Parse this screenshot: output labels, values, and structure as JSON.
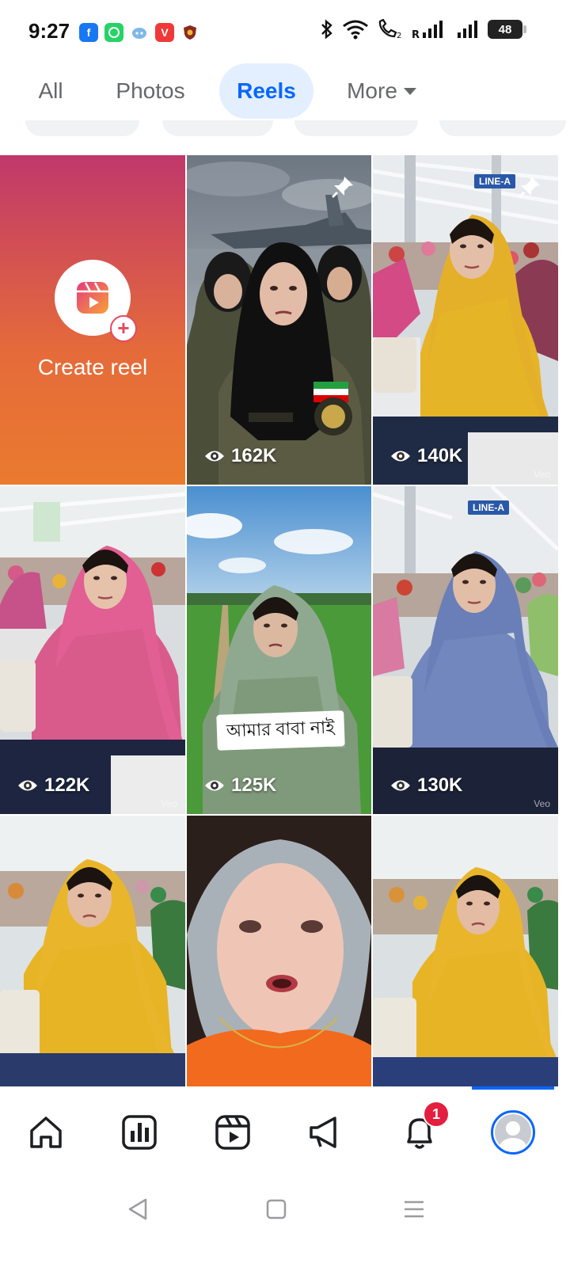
{
  "status_bar": {
    "time": "9:27",
    "battery": "48",
    "app_icons": [
      "facebook-icon",
      "whatsapp-icon",
      "bot-icon",
      "vivaldi-icon",
      "shield-app-icon"
    ],
    "system_icons": [
      "bluetooth-icon",
      "wifi-icon",
      "volte-call-icon",
      "signal-icon",
      "signal-icon"
    ]
  },
  "tabs": [
    {
      "label": "All",
      "active": false
    },
    {
      "label": "Photos",
      "active": false
    },
    {
      "label": "Reels",
      "active": true
    },
    {
      "label": "More",
      "active": false
    }
  ],
  "create_reel": {
    "label": "Create reel"
  },
  "reels": [
    {
      "views": "162K",
      "pinned": true,
      "scene": "army-jet"
    },
    {
      "views": "140K",
      "pinned": true,
      "scene": "factory-yellow",
      "sign": "LINE-A",
      "watermark": "Veo"
    },
    {
      "views": "122K",
      "pinned": false,
      "scene": "factory-pink",
      "watermark": "Veo"
    },
    {
      "views": "125K",
      "pinned": false,
      "scene": "field",
      "caption": "আমার বাবা নাই"
    },
    {
      "views": "130K",
      "pinned": false,
      "scene": "factory-blue",
      "sign": "LINE-A",
      "watermark": "Veo"
    },
    {
      "views": "",
      "pinned": false,
      "scene": "factory-yellow-2"
    },
    {
      "views": "",
      "pinned": false,
      "scene": "closeup-orange"
    },
    {
      "views": "",
      "pinned": false,
      "scene": "factory-yellow-3"
    }
  ],
  "bottom_nav": {
    "items": [
      "home-icon",
      "dashboard-icon",
      "reels-icon",
      "megaphone-icon",
      "notifications-icon",
      "profile-avatar"
    ],
    "notification_count": "1",
    "active": "profile-avatar"
  },
  "colors": {
    "accent": "#0866ff",
    "tab_active_bg": "#e3efff",
    "badge": "#e41e3f"
  }
}
